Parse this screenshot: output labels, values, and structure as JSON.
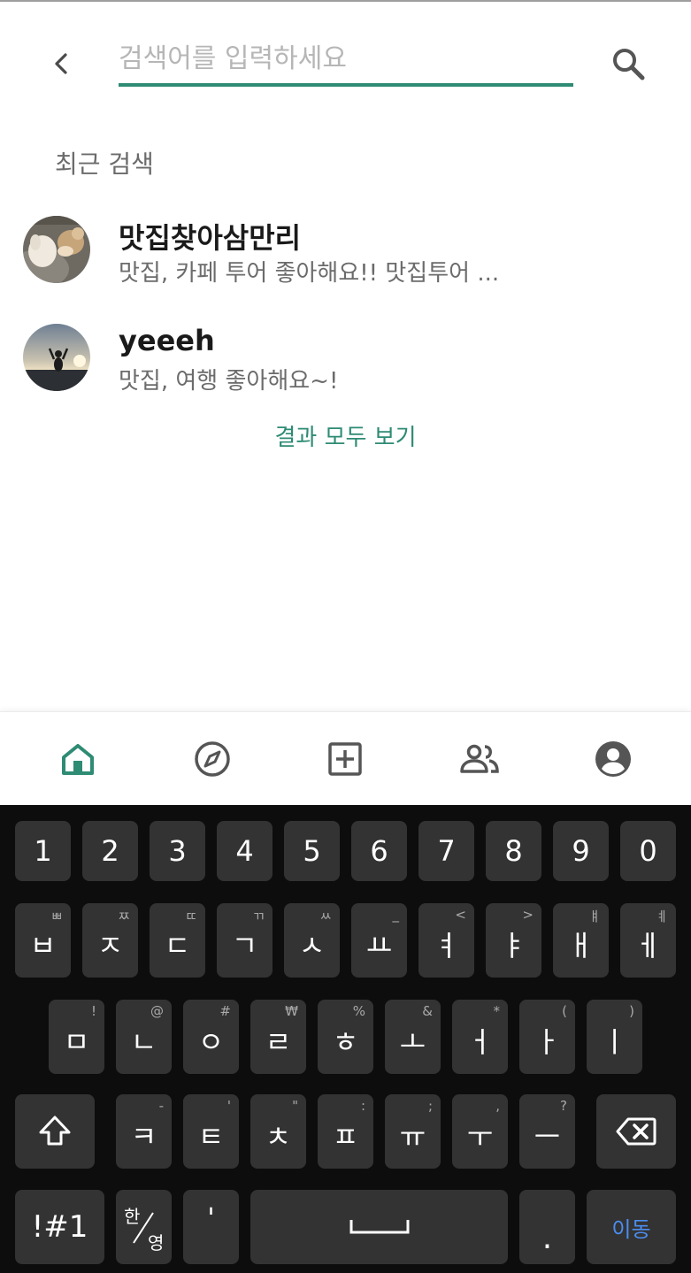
{
  "search": {
    "placeholder": "검색어를 입력하세요",
    "value": ""
  },
  "recent": {
    "title": "최근 검색",
    "items": [
      {
        "name": "맛집찾아삼만리",
        "description": "맛집, 카페 투어 좋아해요!! 맛집투어 ..."
      },
      {
        "name": "yeeeh",
        "description": "맛집, 여행 좋아해요~!"
      }
    ],
    "see_all": "결과 모두 보기"
  },
  "bottom_nav": {
    "items": [
      {
        "icon": "home-icon",
        "active": true
      },
      {
        "icon": "compass-icon",
        "active": false
      },
      {
        "icon": "add-box-icon",
        "active": false
      },
      {
        "icon": "people-icon",
        "active": false
      },
      {
        "icon": "account-icon",
        "active": false
      }
    ]
  },
  "colors": {
    "accent": "#2e8b74",
    "icon_gray": "#555555",
    "keyboard_bg": "#0d0d0d",
    "key_bg": "#333333",
    "enter_text": "#4b8df0"
  },
  "keyboard": {
    "row1": [
      "1",
      "2",
      "3",
      "4",
      "5",
      "6",
      "7",
      "8",
      "9",
      "0"
    ],
    "row2": [
      {
        "main": "ㅂ",
        "hint": "ㅃ"
      },
      {
        "main": "ㅈ",
        "hint": "ㅉ"
      },
      {
        "main": "ㄷ",
        "hint": "ㄸ"
      },
      {
        "main": "ㄱ",
        "hint": "ㄲ"
      },
      {
        "main": "ㅅ",
        "hint": "ㅆ"
      },
      {
        "main": "ㅛ",
        "hint": "_"
      },
      {
        "main": "ㅕ",
        "hint": "<"
      },
      {
        "main": "ㅑ",
        "hint": ">"
      },
      {
        "main": "ㅐ",
        "hint": "ㅒ"
      },
      {
        "main": "ㅔ",
        "hint": "ㅖ"
      }
    ],
    "row3": [
      {
        "main": "ㅁ",
        "hint": "!"
      },
      {
        "main": "ㄴ",
        "hint": "@"
      },
      {
        "main": "ㅇ",
        "hint": "#"
      },
      {
        "main": "ㄹ",
        "hint": "₩"
      },
      {
        "main": "ㅎ",
        "hint": "%"
      },
      {
        "main": "ㅗ",
        "hint": "&"
      },
      {
        "main": "ㅓ",
        "hint": "*"
      },
      {
        "main": "ㅏ",
        "hint": "("
      },
      {
        "main": "ㅣ",
        "hint": ")"
      }
    ],
    "row4": [
      {
        "main": "ㅋ",
        "hint": "-"
      },
      {
        "main": "ㅌ",
        "hint": "'"
      },
      {
        "main": "ㅊ",
        "hint": "\""
      },
      {
        "main": "ㅍ",
        "hint": ":"
      },
      {
        "main": "ㅠ",
        "hint": ";"
      },
      {
        "main": "ㅜ",
        "hint": ","
      },
      {
        "main": "ㅡ",
        "hint": "?"
      }
    ],
    "symbols_label": "!#1",
    "lang_top": "한",
    "lang_bottom": "영",
    "apostrophe": "'",
    "period": ".",
    "enter_label": "이동"
  }
}
